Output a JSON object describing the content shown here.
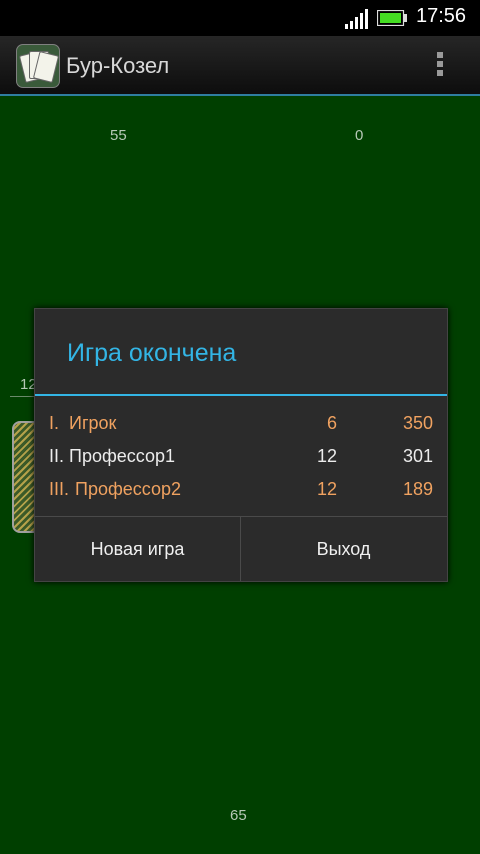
{
  "status_bar": {
    "time": "17:56",
    "icons": [
      "signal-icon",
      "battery-icon"
    ],
    "battery_color": "#44dd22"
  },
  "app_bar": {
    "title": "Бур-Козел",
    "icons": [
      "app-cards-icon",
      "overflow-menu-icon"
    ]
  },
  "table": {
    "background": "#003f00",
    "top_left_score": "55",
    "top_right_score": "0",
    "left_player_score": "12",
    "bottom_score": "65"
  },
  "dialog": {
    "title": "Игра окончена",
    "accent": "#33b5e5",
    "results": [
      {
        "place": "I.",
        "name": "Игрок",
        "tricks": "6",
        "points": "350",
        "color": "orange"
      },
      {
        "place": "II.",
        "name": "Профессор1",
        "tricks": "12",
        "points": "301",
        "color": "white"
      },
      {
        "place": "III.",
        "name": "Профессор2",
        "tricks": "12",
        "points": "189",
        "color": "orange"
      }
    ],
    "buttons": {
      "new_game": "Новая игра",
      "exit": "Выход"
    }
  }
}
